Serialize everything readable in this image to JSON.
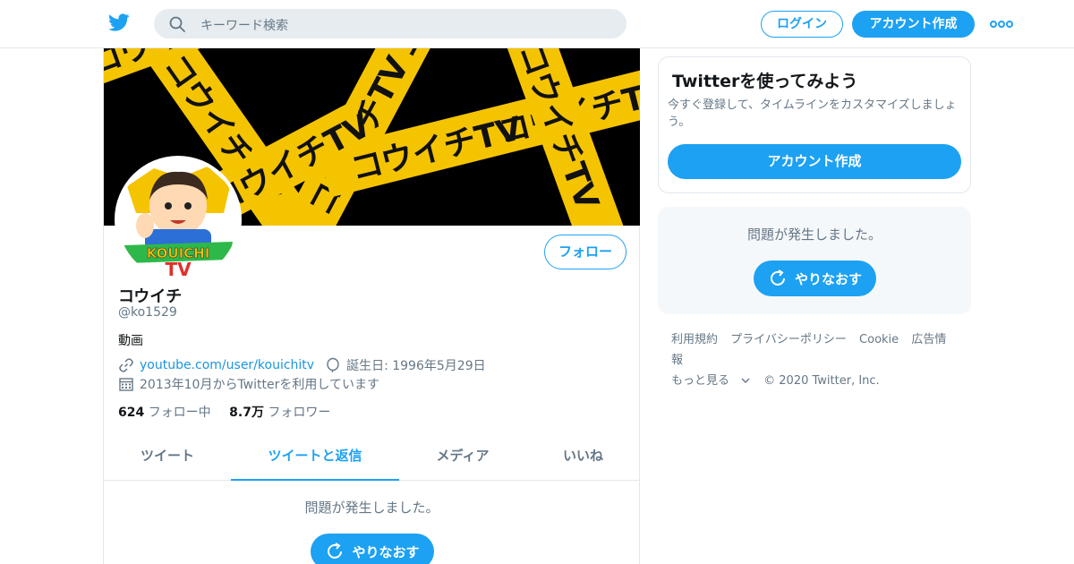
{
  "nav": {
    "search_placeholder": "キーワード検索",
    "login_label": "ログイン",
    "signup_label": "アカウント作成"
  },
  "banner": {
    "tape_text": "コウイチTV"
  },
  "avatar": {
    "logo_text": "KOUICHI TV"
  },
  "profile": {
    "follow_label": "フォロー",
    "name": "コウイチ",
    "handle": "@ko1529",
    "bio": "動画",
    "link": "youtube.com/user/kouichitv",
    "birthday": "誕生日: 1996年5月29日",
    "joined": "2013年10月からTwitterを利用しています",
    "following_count": "624",
    "following_label": "フォロー中",
    "followers_count": "8.7万",
    "followers_label": "フォロワー"
  },
  "tabs": [
    {
      "label": "ツイート",
      "active": false
    },
    {
      "label": "ツイートと返信",
      "active": true
    },
    {
      "label": "メディア",
      "active": false
    },
    {
      "label": "いいね",
      "active": false
    }
  ],
  "main_error": {
    "message": "問題が発生しました。",
    "retry_label": "やりなおす"
  },
  "signup_card": {
    "title": "Twitterを使ってみよう",
    "description": "今すぐ登録して、タイムラインをカスタマイズしましょう。",
    "button_label": "アカウント作成"
  },
  "side_error": {
    "message": "問題が発生しました。",
    "retry_label": "やりなおす"
  },
  "footer": {
    "links": [
      "利用規約",
      "プライバシーポリシー",
      "Cookie",
      "広告情報"
    ],
    "more_label": "もっと見る",
    "copyright": "© 2020 Twitter, Inc."
  },
  "colors": {
    "accent": "#1da1f2",
    "tape_yellow": "#f5c400",
    "secondary_text": "#657786"
  }
}
